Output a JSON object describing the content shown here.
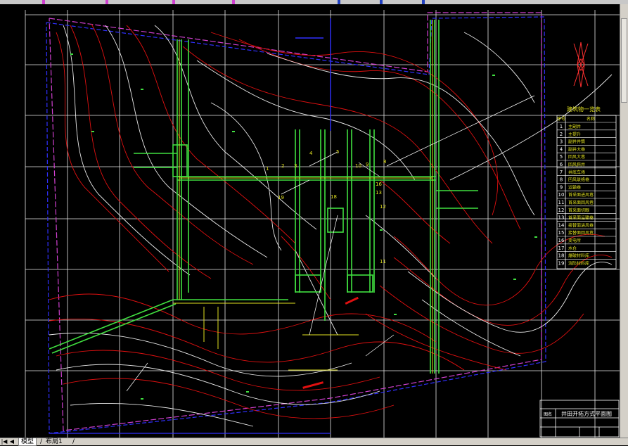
{
  "legend": {
    "title": "建筑物一览表",
    "col_no": "序号",
    "col_name": "名称",
    "rows": [
      {
        "no": "1",
        "name": "主副井"
      },
      {
        "no": "2",
        "name": "主提升"
      },
      {
        "no": "3",
        "name": "副井井筒"
      },
      {
        "no": "4",
        "name": "副井大巷"
      },
      {
        "no": "5",
        "name": "回风大巷"
      },
      {
        "no": "6",
        "name": "回风斜井"
      },
      {
        "no": "7",
        "name": "井底车场"
      },
      {
        "no": "8",
        "name": "回风联络巷"
      },
      {
        "no": "9",
        "name": "运输巷"
      },
      {
        "no": "10",
        "name": "首采面进风巷"
      },
      {
        "no": "11",
        "name": "首采面回风巷"
      },
      {
        "no": "12",
        "name": "首采面切眼"
      },
      {
        "no": "13",
        "name": "首采面运输巷"
      },
      {
        "no": "14",
        "name": "接替面进风巷"
      },
      {
        "no": "15",
        "name": "接替面回风巷"
      },
      {
        "no": "16",
        "name": "变电所"
      },
      {
        "no": "17",
        "name": "水仓"
      },
      {
        "no": "18",
        "name": "爆破材料库"
      },
      {
        "no": "19",
        "name": "消防材料库"
      }
    ]
  },
  "title_block": {
    "label": "图名",
    "title": "井田开拓方式平面图"
  },
  "tabs": {
    "items": [
      {
        "label": "模型"
      },
      {
        "label": "布局1"
      }
    ],
    "nav_first": "|◀",
    "nav_prev": "◀",
    "separator": "/"
  },
  "labels": {
    "l18": "18",
    "l19": "19",
    "l16": "16",
    "l13": "13",
    "l12": "12",
    "l11": "11",
    "l10": "10",
    "l9": "9",
    "l8": "8",
    "l5": "5",
    "l4": "4",
    "l3": "3",
    "l2": "2",
    "l1": "1"
  },
  "colors": {
    "background": "#000000",
    "grid": "#ffffff",
    "contour_red": "#e01010",
    "contour_white": "#e8e8e8",
    "roadway": "#40e040",
    "roadway_yellow": "#e0e020",
    "boundary_magenta": "#d040d0",
    "boundary_blue": "#3030ff",
    "north_arrow": "#ff3030"
  }
}
